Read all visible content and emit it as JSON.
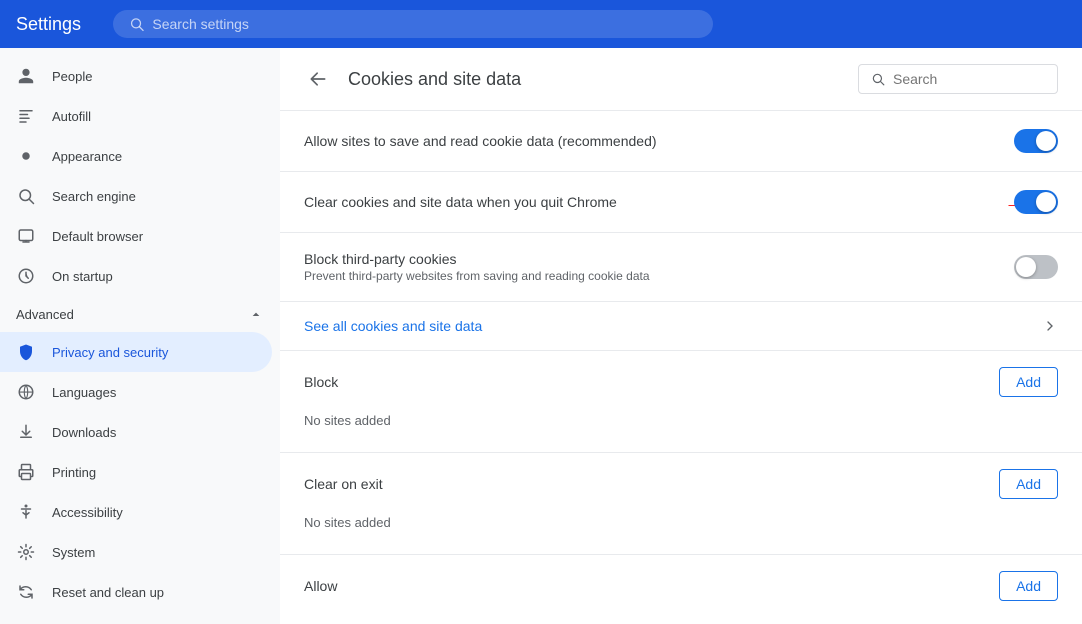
{
  "header": {
    "title": "Settings",
    "search_placeholder": "Search settings"
  },
  "sidebar": {
    "items": [
      {
        "id": "people",
        "label": "People",
        "icon": "person"
      },
      {
        "id": "autofill",
        "label": "Autofill",
        "icon": "autofill"
      },
      {
        "id": "appearance",
        "label": "Appearance",
        "icon": "appearance"
      },
      {
        "id": "search-engine",
        "label": "Search engine",
        "icon": "search"
      },
      {
        "id": "default-browser",
        "label": "Default browser",
        "icon": "browser"
      },
      {
        "id": "on-startup",
        "label": "On startup",
        "icon": "startup"
      }
    ],
    "advanced_label": "Advanced",
    "advanced_items": [
      {
        "id": "privacy",
        "label": "Privacy and security",
        "icon": "shield"
      },
      {
        "id": "languages",
        "label": "Languages",
        "icon": "globe"
      },
      {
        "id": "downloads",
        "label": "Downloads",
        "icon": "download"
      },
      {
        "id": "printing",
        "label": "Printing",
        "icon": "print"
      },
      {
        "id": "accessibility",
        "label": "Accessibility",
        "icon": "accessibility"
      },
      {
        "id": "system",
        "label": "System",
        "icon": "system"
      },
      {
        "id": "reset",
        "label": "Reset and clean up",
        "icon": "reset"
      }
    ]
  },
  "content": {
    "title": "Cookies and site data",
    "search_placeholder": "Search",
    "rows": [
      {
        "id": "allow-sites",
        "label": "Allow sites to save and read cookie data (recommended)",
        "toggle": "on"
      },
      {
        "id": "clear-cookies",
        "label": "Clear cookies and site data when you quit Chrome",
        "toggle": "on",
        "has_arrow": true
      },
      {
        "id": "block-third-party",
        "label": "Block third-party cookies",
        "sublabel": "Prevent third-party websites from saving and reading cookie data",
        "toggle": "off"
      }
    ],
    "see_all_label": "See all cookies and site data",
    "block_section": {
      "title": "Block",
      "add_label": "Add",
      "empty_label": "No sites added"
    },
    "clear_on_exit_section": {
      "title": "Clear on exit",
      "add_label": "Add",
      "empty_label": "No sites added"
    },
    "allow_section": {
      "title": "Allow",
      "add_label": "Add"
    }
  }
}
